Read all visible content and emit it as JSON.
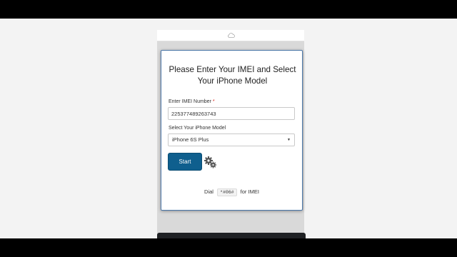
{
  "form": {
    "title": "Please Enter Your IMEI and Select Your iPhone Model",
    "imei_label": "Enter IMEI Number",
    "required_mark": "*",
    "imei_value": "225377489263743",
    "model_label": "Select Your iPhone Model",
    "model_selected": "iPhone 6S Plus",
    "start_label": "Start",
    "dial_prefix": "Dial",
    "dial_code": "*#06#",
    "dial_suffix": "for IMEI"
  },
  "icons": {
    "top": "cloud-icon",
    "select": "chevron-down-icon",
    "busy": "gears-icon"
  },
  "colors": {
    "accent": "#0f5f8e",
    "card_border": "#4a76a8",
    "required": "#d9261c"
  }
}
